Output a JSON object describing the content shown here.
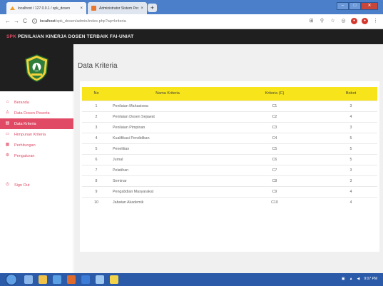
{
  "browser": {
    "tabs": [
      {
        "title": "localhost / 127.0.0.1 / spk_dosen"
      },
      {
        "title": "Administrator Sistem Pendukung"
      }
    ],
    "url_host": "localhost",
    "url_path": "/spk_dosen/admin/index.php?ap=kriteria"
  },
  "app": {
    "brand_prefix": "SPK",
    "brand_rest": "PENILAIAN KINERJA DOSEN TERBAIK FAI-UNIAT"
  },
  "sidebar": {
    "items": [
      {
        "label": "Beranda",
        "icon": "home-icon"
      },
      {
        "label": "Data Dosen Peserta",
        "icon": "user-icon"
      },
      {
        "label": "Data Kriteria",
        "icon": "list-icon"
      },
      {
        "label": "Himpunan Kriteria",
        "icon": "calendar-icon"
      },
      {
        "label": "Perhitungan",
        "icon": "calculator-icon"
      },
      {
        "label": "Pengaturan",
        "icon": "gear-icon"
      },
      {
        "label": "Sign Out",
        "icon": "signout-icon"
      }
    ]
  },
  "main": {
    "title": "Data Kriteria",
    "table": {
      "headers": [
        "No",
        "Nama Kriteria",
        "Kriteria (C)",
        "Bobot"
      ],
      "rows": [
        [
          "1",
          "Penilaian Mahasiswa",
          "C1",
          "3"
        ],
        [
          "2",
          "Penilaian Dosen Sejawat",
          "C2",
          "4"
        ],
        [
          "3",
          "Penilaian Pimpinan",
          "C3",
          "3"
        ],
        [
          "4",
          "Kualifikasi Pendidikan",
          "C4",
          "5"
        ],
        [
          "5",
          "Penelitian",
          "C5",
          "5"
        ],
        [
          "6",
          "Jurnal",
          "C6",
          "5"
        ],
        [
          "7",
          "Pelatihan",
          "C7",
          "3"
        ],
        [
          "8",
          "Seminar",
          "C8",
          "3"
        ],
        [
          "9",
          "Pengabdian Masyarakat",
          "C9",
          "4"
        ],
        [
          "10",
          "Jabatan Akademik",
          "C10",
          "4"
        ]
      ]
    }
  },
  "taskbar": {
    "clock": "9:07 PM"
  },
  "colors": {
    "accent": "#e04a64",
    "header_yellow": "#f7e41a",
    "dark": "#1f1f1f"
  }
}
